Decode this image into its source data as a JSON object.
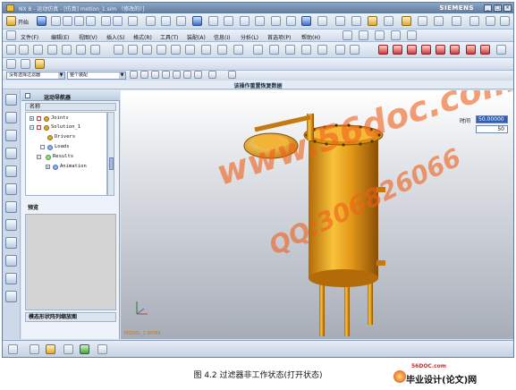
{
  "window": {
    "title": "NX 8 - 运动仿真 - [仿真] motion_1.sim （修改的）]",
    "brand": "SIEMENS",
    "controls": [
      "_",
      "□",
      "×"
    ]
  },
  "toolbar1": {
    "start_label": "开始"
  },
  "menu": {
    "items": [
      "文件(F)",
      "编辑(E)",
      "视图(V)",
      "插入(S)",
      "格式(R)",
      "工具(T)",
      "装配(A)",
      "信息(I)",
      "分析(L)",
      "首选项(P)",
      "帮助(H)"
    ]
  },
  "filters": {
    "type_filter": "没有选择过滤器",
    "assembly_scope": "整个装配"
  },
  "status": {
    "message": "该操作重置恢复数据"
  },
  "navigator": {
    "title": "运动导航器",
    "column_name": "名称",
    "tree": [
      {
        "label": "Joints",
        "level": 1
      },
      {
        "label": "Solution_1",
        "level": 1
      },
      {
        "label": "Drivers",
        "level": 2
      },
      {
        "label": "Loads",
        "level": 2
      },
      {
        "label": "Results",
        "level": 2
      },
      {
        "label": "Animation",
        "level": 3
      }
    ],
    "preview_label": "预览",
    "footer_label": "模态形状阵列缩放图"
  },
  "viewport": {
    "time_label": "时间",
    "time_value": "50.00000",
    "step_value": "50",
    "work_label": "MODEL_1 WORK"
  },
  "caption": {
    "text": "图 4.2  过滤器非工作状态(打开状态)"
  },
  "logo": {
    "domain": "56DOC.com",
    "name": "毕业设计(论文)网"
  },
  "watermark": {
    "line1": "www.56doc.com",
    "line2": "QQ:306826066"
  }
}
